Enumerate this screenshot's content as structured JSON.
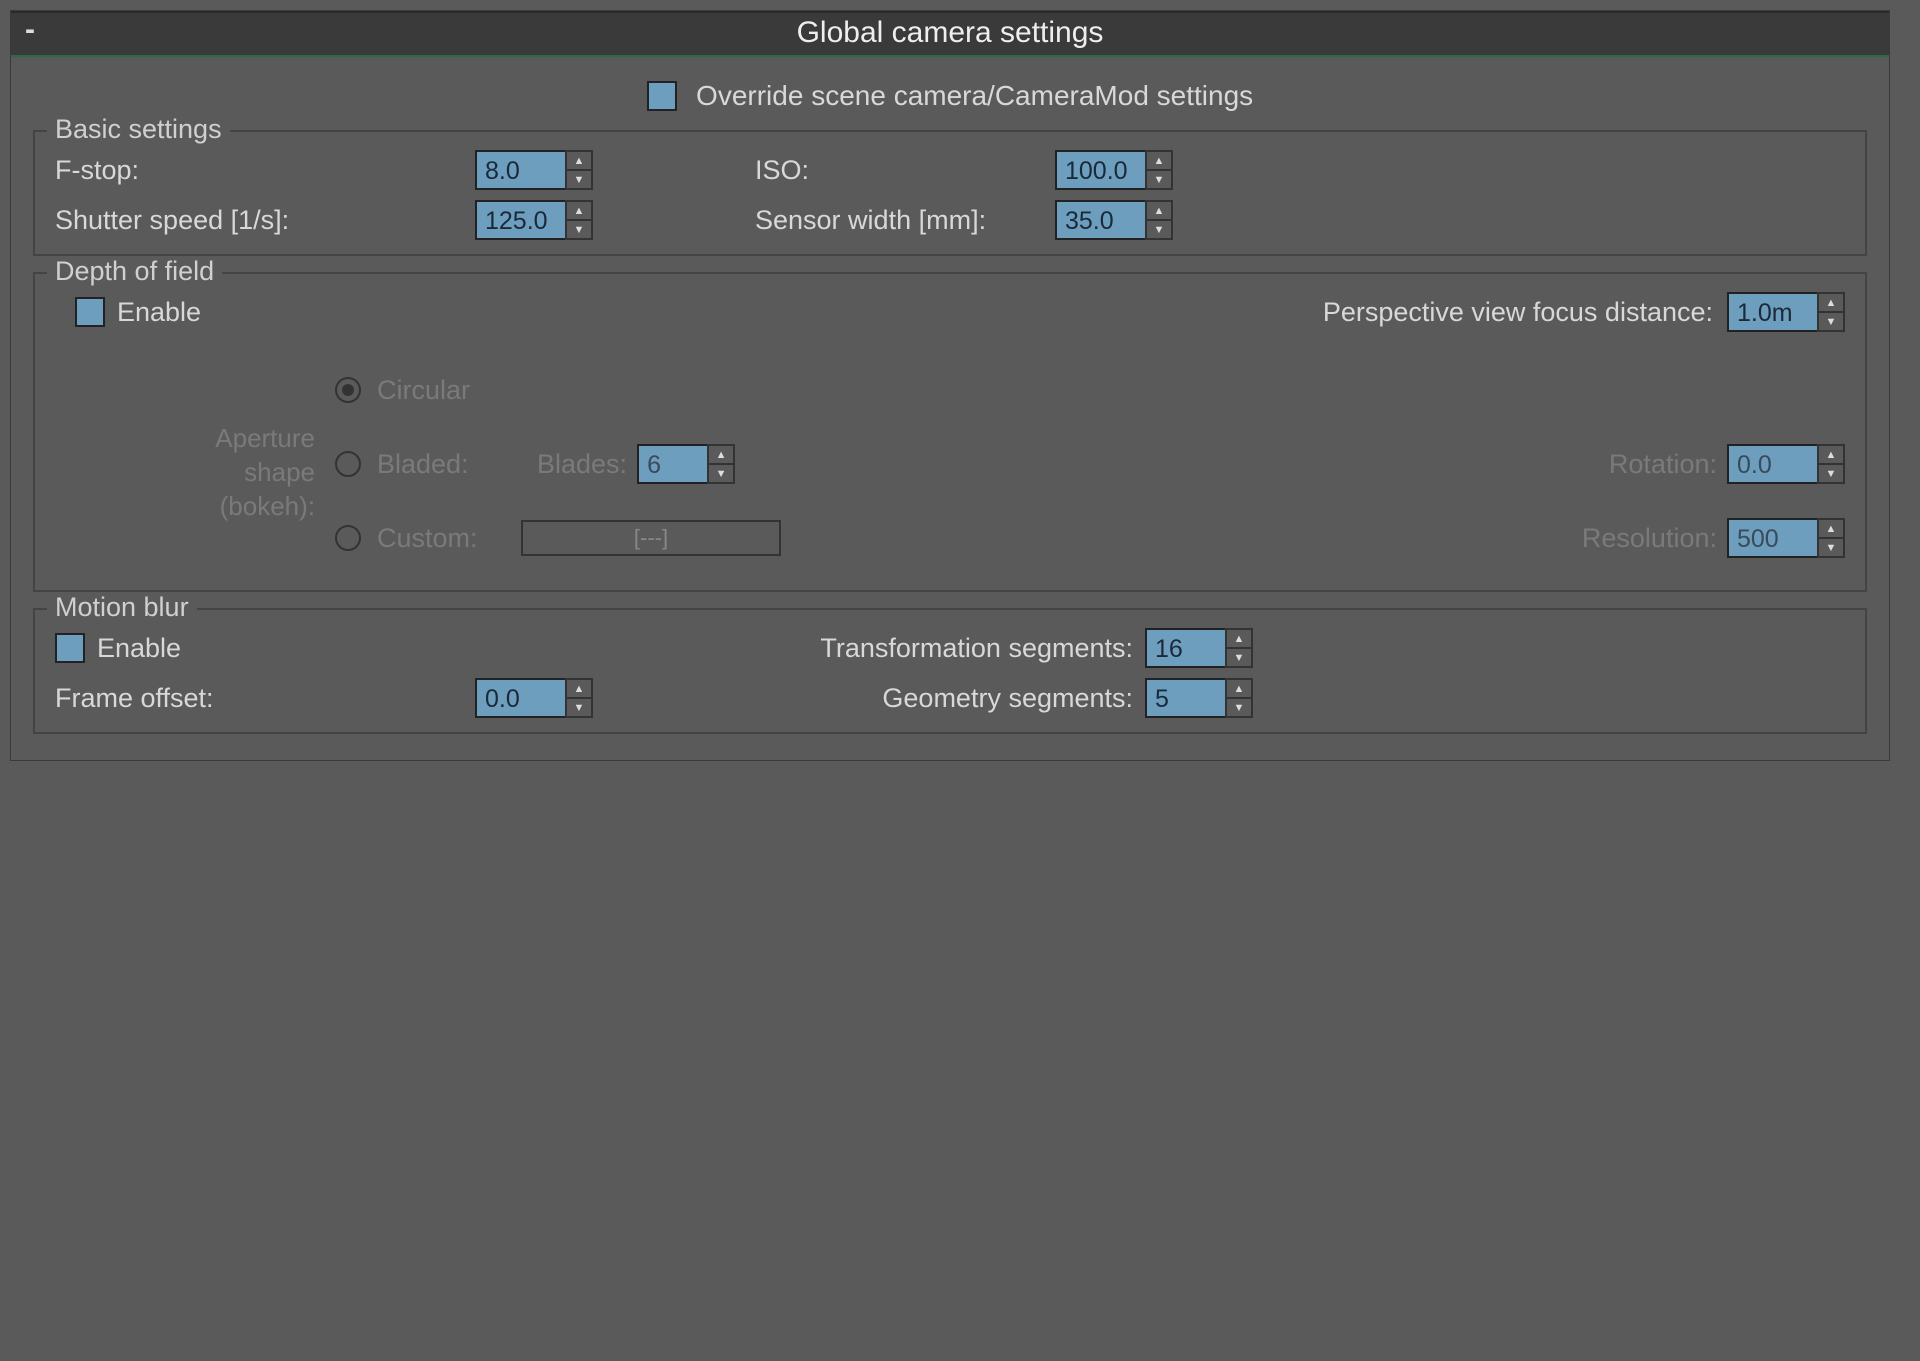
{
  "panel": {
    "title": "Global camera settings",
    "override": {
      "label": "Override scene camera/CameraMod settings",
      "checked": false
    }
  },
  "basic": {
    "legend": "Basic settings",
    "fstop": {
      "label": "F-stop:",
      "value": "8.0"
    },
    "shutter": {
      "label": "Shutter speed [1/s]:",
      "value": "125.0"
    },
    "iso": {
      "label": "ISO:",
      "value": "100.0"
    },
    "sensor": {
      "label": "Sensor width [mm]:",
      "value": "35.0"
    }
  },
  "dof": {
    "legend": "Depth of field",
    "enable": {
      "label": "Enable",
      "checked": false
    },
    "focus": {
      "label": "Perspective view focus distance:",
      "value": "1.0m"
    },
    "aperture_label_l1": "Aperture",
    "aperture_label_l2": "shape",
    "aperture_label_l3": "(bokeh):",
    "circular": "Circular",
    "bladed": "Bladed:",
    "custom": "Custom:",
    "custom_placeholder": "[---]",
    "blades": {
      "label": "Blades:",
      "value": "6"
    },
    "rotation": {
      "label": "Rotation:",
      "value": "0.0"
    },
    "resolution": {
      "label": "Resolution:",
      "value": "500"
    }
  },
  "mb": {
    "legend": "Motion blur",
    "enable": {
      "label": "Enable",
      "checked": false
    },
    "frame_offset": {
      "label": "Frame offset:",
      "value": "0.0"
    },
    "transform_segments": {
      "label": "Transformation segments:",
      "value": "16"
    },
    "geometry_segments": {
      "label": "Geometry segments:",
      "value": "5"
    }
  }
}
